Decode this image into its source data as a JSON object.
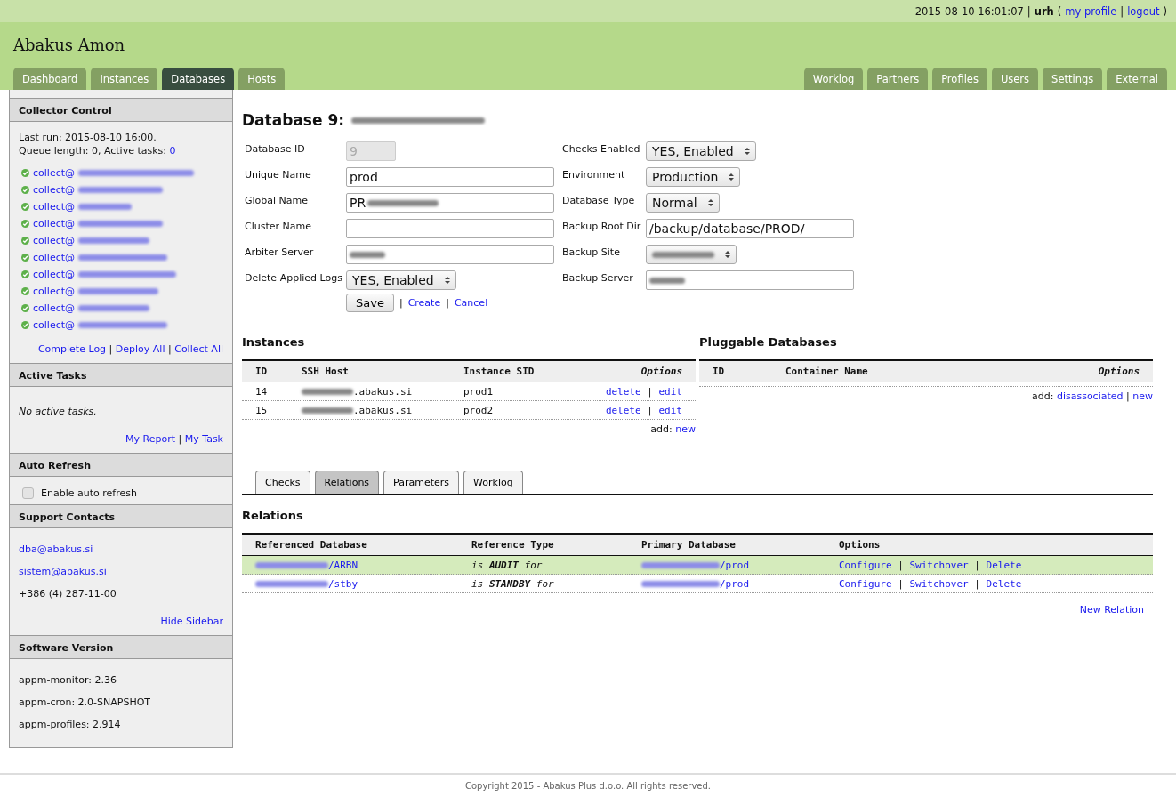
{
  "top_bar": {
    "datetime": "2015-08-10 16:01:07",
    "separator": "|",
    "user": "urh",
    "paren_open": "(",
    "paren_close": ")",
    "links": [
      "my profile",
      "logout"
    ]
  },
  "app_title": "Abakus Amon",
  "nav_left": [
    {
      "label": "Dashboard",
      "selected": false
    },
    {
      "label": "Instances",
      "selected": false
    },
    {
      "label": "Databases",
      "selected": true
    },
    {
      "label": "Hosts",
      "selected": false
    }
  ],
  "nav_right": [
    {
      "label": "Worklog",
      "selected": false
    },
    {
      "label": "Partners",
      "selected": false
    },
    {
      "label": "Profiles",
      "selected": false
    },
    {
      "label": "Users",
      "selected": false
    },
    {
      "label": "Settings",
      "selected": false
    },
    {
      "label": "External",
      "selected": false
    }
  ],
  "sidebar": {
    "collector": {
      "title": "Collector Control",
      "last_run": "Last run: 2015-08-10 16:00.",
      "queue": "Queue length: 0, Active tasks:",
      "active_count": "0",
      "collectors": [
        {
          "label": "collect@",
          "ok": true
        },
        {
          "label": "collect@",
          "ok": true
        },
        {
          "label": "collect@",
          "ok": true
        },
        {
          "label": "collect@",
          "ok": true
        },
        {
          "label": "collect@",
          "ok": true
        },
        {
          "label": "collect@",
          "ok": true
        },
        {
          "label": "collect@",
          "ok": true
        },
        {
          "label": "collect@",
          "ok": true
        },
        {
          "label": "collect@",
          "ok": true
        },
        {
          "label": "collect@",
          "ok": true
        }
      ],
      "links": [
        "Complete Log",
        "Deploy All",
        "Collect All"
      ],
      "separator": "|"
    },
    "active_tasks": {
      "title": "Active Tasks",
      "message": "No active tasks.",
      "links": [
        "My Report",
        "My Task"
      ],
      "separator": "|"
    },
    "auto_refresh": {
      "title": "Auto Refresh",
      "label": "Enable auto refresh",
      "checked": false
    },
    "support": {
      "title": "Support Contacts",
      "emails": [
        "dba@abakus.si",
        "sistem@abakus.si"
      ],
      "phone": "+386 (4) 287-11-00",
      "hide_link": "Hide Sidebar"
    },
    "versions": {
      "title": "Software Version",
      "items": [
        "appm-monitor: 2.36",
        "appm-cron: 2.0-SNAPSHOT",
        "appm-profiles: 2.914"
      ]
    }
  },
  "database": {
    "title": "Database 9:",
    "title_redacted": true,
    "fields_left": [
      {
        "label": "Database ID",
        "kind": "input",
        "value": "9",
        "disabled": true,
        "redacted": false
      },
      {
        "label": "Unique Name",
        "kind": "input",
        "value": "prod",
        "disabled": false,
        "redacted": false
      },
      {
        "label": "Global Name",
        "kind": "input",
        "value": "PR",
        "disabled": false,
        "redacted": true
      },
      {
        "label": "Cluster Name",
        "kind": "input",
        "disabled": false,
        "redacted": false
      },
      {
        "label": "Arbiter Server",
        "kind": "input",
        "disabled": false,
        "redacted": true
      },
      {
        "label": "Delete Applied Logs",
        "kind": "select",
        "value": "YES, Enabled",
        "disabled": false,
        "redacted": false
      }
    ],
    "fields_right": [
      {
        "label": "Checks Enabled",
        "kind": "select",
        "value": "YES, Enabled",
        "disabled": false,
        "redacted": false
      },
      {
        "label": "Environment",
        "kind": "select",
        "value": "Production",
        "disabled": false,
        "redacted": false
      },
      {
        "label": "Database Type",
        "kind": "select",
        "value": "Normal",
        "disabled": false,
        "redacted": false
      },
      {
        "label": "Backup Root Dir",
        "kind": "input",
        "value": "/backup/database/PROD/",
        "disabled": false,
        "redacted": false
      },
      {
        "label": "Backup Site",
        "kind": "select",
        "disabled": false,
        "redacted": true
      },
      {
        "label": "Backup Server",
        "kind": "input",
        "disabled": false,
        "redacted": true
      }
    ],
    "save_button": "Save",
    "links": [
      "Create",
      "Cancel"
    ],
    "separator": "|"
  },
  "instances": {
    "title": "Instances",
    "columns": [
      "ID",
      "SSH Host",
      "Instance SID",
      "Options"
    ],
    "rows": [
      {
        "id": "14",
        "host": ".abakus.si",
        "sid": "prod1",
        "actions": [
          "delete",
          "edit"
        ]
      },
      {
        "id": "15",
        "host": ".abakus.si",
        "sid": "prod2",
        "actions": [
          "delete",
          "edit"
        ]
      }
    ],
    "add_label": "add:",
    "add_links": [
      "new"
    ],
    "separator": "|"
  },
  "pluggable": {
    "title": "Pluggable Databases",
    "columns": [
      "ID",
      "Container Name",
      "Options"
    ],
    "add_label": "add:",
    "add_links": [
      "disassociated",
      "new"
    ],
    "separator": "|"
  },
  "sub_tabs": [
    {
      "label": "Checks",
      "selected": false
    },
    {
      "label": "Relations",
      "selected": true
    },
    {
      "label": "Parameters",
      "selected": false
    },
    {
      "label": "Worklog",
      "selected": false
    }
  ],
  "relations": {
    "title": "Relations",
    "columns": [
      "Referenced Database",
      "Reference Type",
      "Primary Database",
      "Options"
    ],
    "rows": [
      {
        "referenced": "/ARBN",
        "type": "is **AUDIT** for",
        "primary": "/prod",
        "actions": [
          "Configure",
          "Switchover",
          "Delete"
        ],
        "selected": true
      },
      {
        "referenced": "/stby",
        "type": "is **STANDBY** for",
        "primary": "/prod",
        "actions": [
          "Configure",
          "Switchover",
          "Delete"
        ],
        "selected": false
      }
    ],
    "new_link": "New Relation",
    "separator": "|"
  },
  "footer": "Copyright 2015 - Abakus Plus d.o.o. All rights reserved."
}
